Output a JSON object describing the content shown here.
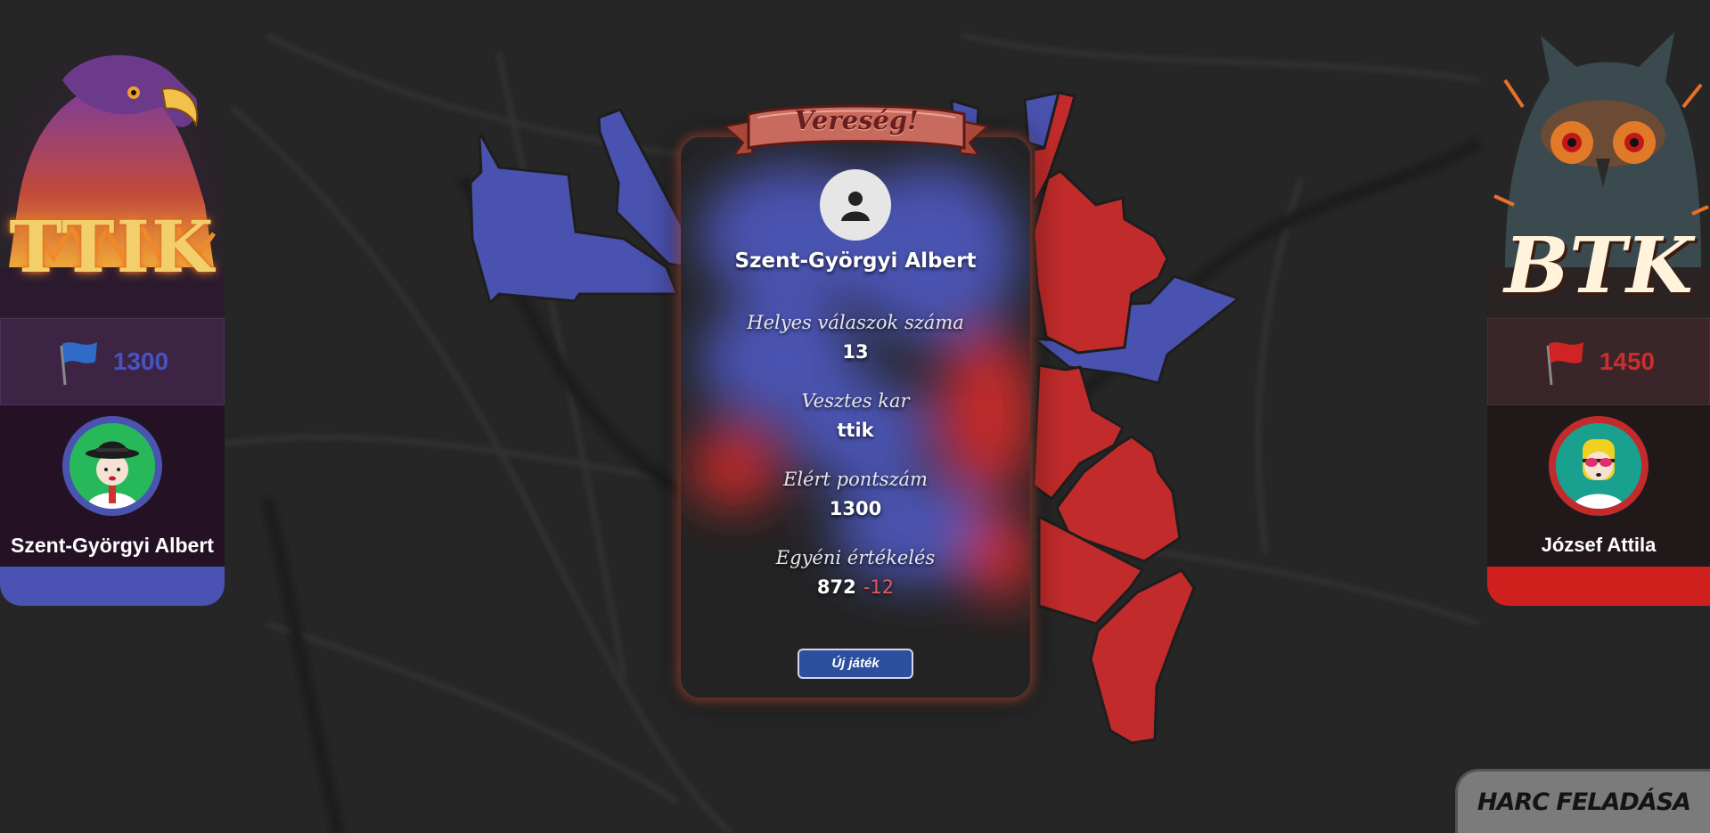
{
  "result": {
    "title": "Vereség!",
    "player_name": "Szent-Györgyi Albert",
    "stats": [
      {
        "label": "Helyes válaszok száma",
        "value": "13"
      },
      {
        "label": "Vesztes kar",
        "value": "ttik"
      },
      {
        "label": "Elért pontszám",
        "value": "1300"
      },
      {
        "label": "Egyéni értékelés",
        "value": "872",
        "delta": "-12"
      }
    ],
    "new_game_label": "Új játék"
  },
  "left_team": {
    "faculty": "TTIK",
    "score": "1300",
    "player_name": "Szent-Györgyi Albert",
    "color": "#4a52b4",
    "flag_icon": "blue-flag-icon",
    "emblem_icon": "eagle-icon"
  },
  "right_team": {
    "faculty": "BTK",
    "score": "1450",
    "player_name": "József Attila",
    "color": "#d0201e",
    "flag_icon": "red-flag-icon",
    "emblem_icon": "owl-icon"
  },
  "controls": {
    "surrender_label": "HARC FELADÁSA"
  }
}
